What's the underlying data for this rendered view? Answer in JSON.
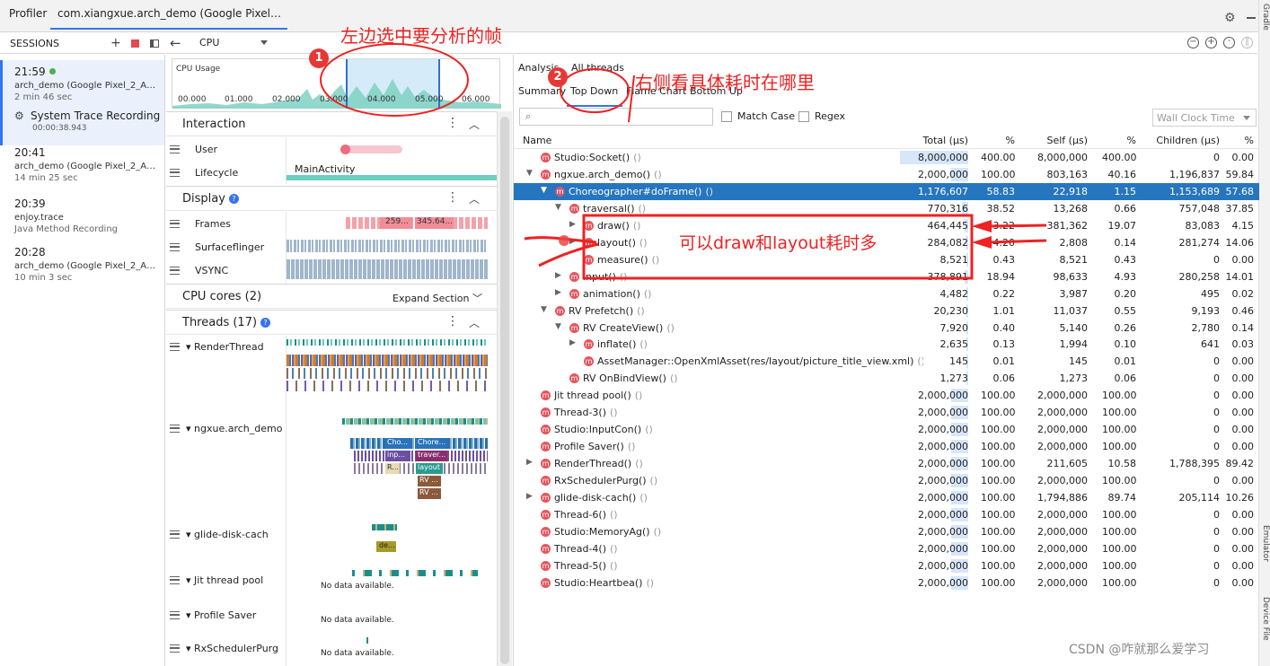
{
  "tabs": {
    "profiler": "Profiler",
    "session": "com.xiangxue.arch_demo (Google Pixel_2_API_..."
  },
  "right_stripe": [
    "Gradle",
    "Emulator",
    "Device File"
  ],
  "sessions": {
    "title": "SESSIONS",
    "items": [
      {
        "time": "21:59",
        "name": "arch_demo (Google Pixel_2_API_...",
        "duration": "2 min 46 sec",
        "trace_label": "System Trace Recording",
        "trace_duration": "00:00:38.943"
      },
      {
        "time": "20:41",
        "name": "arch_demo (Google Pixel_2_API_...",
        "duration": "14 min 25 sec"
      },
      {
        "time": "20:39",
        "name": "enjoy.trace",
        "duration": "Java Method Recording"
      },
      {
        "time": "20:28",
        "name": "arch_demo (Google Pixel_2_API_...",
        "duration": "10 min 3 sec"
      }
    ]
  },
  "toolbar": {
    "cpu_select": "CPU"
  },
  "cpu_usage": {
    "label": "CPU Usage",
    "ticks": [
      "00.000",
      "01.000",
      "02.000",
      "03.000",
      "04.000",
      "05.000",
      "06.000"
    ],
    "selection_start_s": 3.3,
    "selection_end_s": 5.2
  },
  "tracks": {
    "interaction": {
      "title": "Interaction",
      "rows": [
        "User",
        "Lifecycle"
      ],
      "lifecycle_event": "MainActivity"
    },
    "display": {
      "title": "Display",
      "rows": [
        "Frames",
        "Surfaceflinger",
        "VSYNC"
      ],
      "frame_labels": [
        "259...",
        "345.64..."
      ]
    },
    "cpu_cores": {
      "title": "CPU cores (2)",
      "action": "Expand Section"
    },
    "threads": {
      "title": "Threads (17)",
      "rows": [
        "RenderThread",
        "ngxue.arch_demo",
        "glide-disk-cach",
        "Jit thread pool",
        "Profile Saver",
        "RxSchedulerPurg"
      ],
      "chunks": [
        "Cho...",
        "Chore...",
        "inp...",
        "traver...",
        "R...",
        "layout",
        "RV ...",
        "RV ...",
        "RV ..."
      ],
      "glide_chunk": "de...",
      "no_data": "No data available."
    }
  },
  "analysis": {
    "tabs": [
      "Analysis",
      "All threads"
    ],
    "subtabs": [
      "Summary",
      "Top Down",
      "Flame Chart",
      "Bottom Up"
    ],
    "selected_subtab": "Top Down",
    "match_case": "Match Case",
    "regex": "Regex",
    "clock": "Wall Clock Time",
    "columns": [
      "Name",
      "Total (μs)",
      "%",
      "Self (μs)",
      "%",
      "Children (μs)",
      "%"
    ],
    "rows": [
      {
        "depth": 0,
        "arrow": "",
        "name": "Studio:Socket()",
        "total": "8,000,000",
        "tp": "400.00",
        "self": "8,000,000",
        "sp": "400.00",
        "children": "0",
        "cp": "0.00"
      },
      {
        "depth": 0,
        "arrow": "▼",
        "name": "ngxue.arch_demo()",
        "total": "2,000,000",
        "tp": "100.00",
        "self": "803,163",
        "sp": "40.16",
        "children": "1,196,837",
        "cp": "59.84"
      },
      {
        "depth": 1,
        "arrow": "▼",
        "name": "Choreographer#doFrame()",
        "total": "1,176,607",
        "tp": "58.83",
        "self": "22,918",
        "sp": "1.15",
        "children": "1,153,689",
        "cp": "57.68",
        "selected": true
      },
      {
        "depth": 2,
        "arrow": "▼",
        "name": "traversal()",
        "total": "770,316",
        "tp": "38.52",
        "self": "13,268",
        "sp": "0.66",
        "children": "757,048",
        "cp": "37.85"
      },
      {
        "depth": 3,
        "arrow": "▶",
        "name": "draw()",
        "total": "464,445",
        "tp": "23.22",
        "self": "381,362",
        "sp": "19.07",
        "children": "83,083",
        "cp": "4.15"
      },
      {
        "depth": 3,
        "arrow": "▶",
        "name": "layout()",
        "total": "284,082",
        "tp": "14.20",
        "self": "2,808",
        "sp": "0.14",
        "children": "281,274",
        "cp": "14.06"
      },
      {
        "depth": 3,
        "arrow": "",
        "name": "measure()",
        "total": "8,521",
        "tp": "0.43",
        "self": "8,521",
        "sp": "0.43",
        "children": "0",
        "cp": "0.00"
      },
      {
        "depth": 2,
        "arrow": "▶",
        "name": "input()",
        "total": "378,891",
        "tp": "18.94",
        "self": "98,633",
        "sp": "4.93",
        "children": "280,258",
        "cp": "14.01"
      },
      {
        "depth": 2,
        "arrow": "▶",
        "name": "animation()",
        "total": "4,482",
        "tp": "0.22",
        "self": "3,987",
        "sp": "0.20",
        "children": "495",
        "cp": "0.02"
      },
      {
        "depth": 1,
        "arrow": "▼",
        "name": "RV Prefetch()",
        "total": "20,230",
        "tp": "1.01",
        "self": "11,037",
        "sp": "0.55",
        "children": "9,193",
        "cp": "0.46"
      },
      {
        "depth": 2,
        "arrow": "▼",
        "name": "RV CreateView()",
        "total": "7,920",
        "tp": "0.40",
        "self": "5,140",
        "sp": "0.26",
        "children": "2,780",
        "cp": "0.14"
      },
      {
        "depth": 3,
        "arrow": "▶",
        "name": "inflate()",
        "total": "2,635",
        "tp": "0.13",
        "self": "1,994",
        "sp": "0.10",
        "children": "641",
        "cp": "0.03"
      },
      {
        "depth": 3,
        "arrow": "",
        "name": "AssetManager::OpenXmlAsset(res/layout/picture_title_view.xml)",
        "total": "145",
        "tp": "0.01",
        "self": "145",
        "sp": "0.01",
        "children": "0",
        "cp": "0.00"
      },
      {
        "depth": 2,
        "arrow": "",
        "name": "RV OnBindView()",
        "total": "1,273",
        "tp": "0.06",
        "self": "1,273",
        "sp": "0.06",
        "children": "0",
        "cp": "0.00"
      },
      {
        "depth": 0,
        "arrow": "",
        "name": "Jit thread pool()",
        "total": "2,000,000",
        "tp": "100.00",
        "self": "2,000,000",
        "sp": "100.00",
        "children": "0",
        "cp": "0.00"
      },
      {
        "depth": 0,
        "arrow": "",
        "name": "Thread-3()",
        "total": "2,000,000",
        "tp": "100.00",
        "self": "2,000,000",
        "sp": "100.00",
        "children": "0",
        "cp": "0.00"
      },
      {
        "depth": 0,
        "arrow": "",
        "name": "Studio:InputCon()",
        "total": "2,000,000",
        "tp": "100.00",
        "self": "2,000,000",
        "sp": "100.00",
        "children": "0",
        "cp": "0.00"
      },
      {
        "depth": 0,
        "arrow": "",
        "name": "Profile Saver()",
        "total": "2,000,000",
        "tp": "100.00",
        "self": "2,000,000",
        "sp": "100.00",
        "children": "0",
        "cp": "0.00"
      },
      {
        "depth": 0,
        "arrow": "▶",
        "name": "RenderThread()",
        "total": "2,000,000",
        "tp": "100.00",
        "self": "211,605",
        "sp": "10.58",
        "children": "1,788,395",
        "cp": "89.42"
      },
      {
        "depth": 0,
        "arrow": "",
        "name": "RxSchedulerPurg()",
        "total": "2,000,000",
        "tp": "100.00",
        "self": "2,000,000",
        "sp": "100.00",
        "children": "0",
        "cp": "0.00"
      },
      {
        "depth": 0,
        "arrow": "▶",
        "name": "glide-disk-cach()",
        "total": "2,000,000",
        "tp": "100.00",
        "self": "1,794,886",
        "sp": "89.74",
        "children": "205,114",
        "cp": "10.26"
      },
      {
        "depth": 0,
        "arrow": "",
        "name": "Thread-6()",
        "total": "2,000,000",
        "tp": "100.00",
        "self": "2,000,000",
        "sp": "100.00",
        "children": "0",
        "cp": "0.00"
      },
      {
        "depth": 0,
        "arrow": "",
        "name": "Studio:MemoryAg()",
        "total": "2,000,000",
        "tp": "100.00",
        "self": "2,000,000",
        "sp": "100.00",
        "children": "0",
        "cp": "0.00"
      },
      {
        "depth": 0,
        "arrow": "",
        "name": "Thread-4()",
        "total": "2,000,000",
        "tp": "100.00",
        "self": "2,000,000",
        "sp": "100.00",
        "children": "0",
        "cp": "0.00"
      },
      {
        "depth": 0,
        "arrow": "",
        "name": "Thread-5()",
        "total": "2,000,000",
        "tp": "100.00",
        "self": "2,000,000",
        "sp": "100.00",
        "children": "0",
        "cp": "0.00"
      },
      {
        "depth": 0,
        "arrow": "",
        "name": "Studio:Heartbea()",
        "total": "2,000,000",
        "tp": "100.00",
        "self": "2,000,000",
        "sp": "100.00",
        "children": "0",
        "cp": "0.00"
      }
    ]
  },
  "annotations": {
    "badge1": "1",
    "text1": "左边选中要分析的帧",
    "badge2": "2",
    "text2": "右侧看具体耗时在哪里",
    "text3": "可以draw和layout耗时多"
  },
  "watermark": "CSDN @咋就那么爱学习",
  "colors": {
    "accent": "#3574f0",
    "selected_row": "#2675bf",
    "annotation": "#ee2222",
    "method_badge": "#e5555c"
  }
}
